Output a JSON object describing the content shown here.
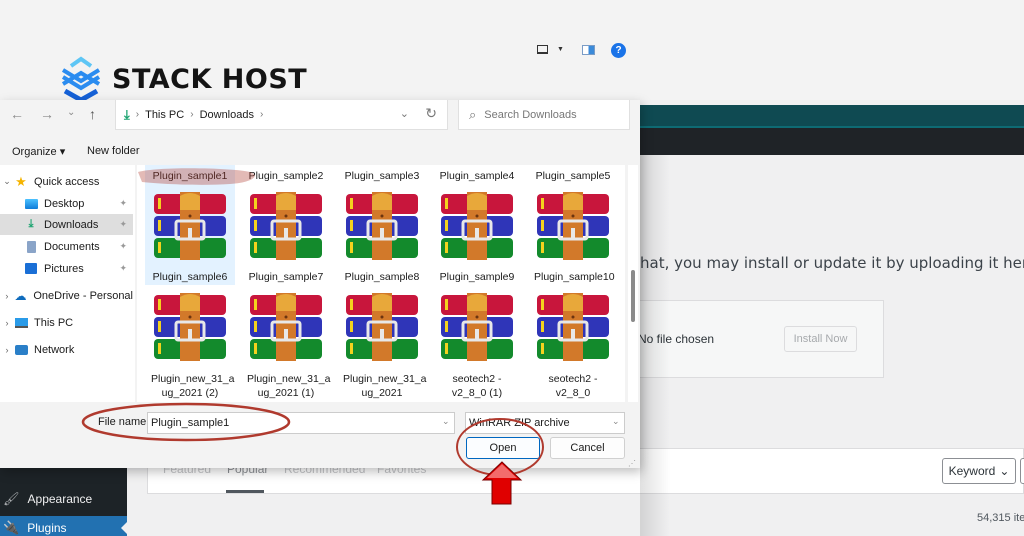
{
  "brand": {
    "name": "STACK HOST",
    "logo_icon": "stacked-chevrons-icon",
    "colors": {
      "light": "#5ec6f5",
      "mid": "#2b8cf0",
      "dark": "#1560d6"
    }
  },
  "dialog": {
    "nav": {
      "back_icon": "←",
      "forward_icon": "→",
      "recent_icon": "⌄",
      "up_icon": "↑",
      "breadcrumb": [
        "This PC",
        "Downloads"
      ],
      "breadcrumb_sep": "›",
      "dropdown_icon": "⌄",
      "refresh_icon": "↻"
    },
    "search": {
      "placeholder": "Search Downloads",
      "icon": "⌕"
    },
    "toolbar": {
      "organize_label": "Organize ▾",
      "new_folder_label": "New folder",
      "help_label": "?"
    },
    "nav_pane": {
      "items": [
        {
          "label": "Quick access",
          "icon": "star-icon",
          "chevron": "⌄",
          "pinned": false,
          "selected": false
        },
        {
          "label": "Desktop",
          "icon": "desktop-icon",
          "pinned": true,
          "selected": false
        },
        {
          "label": "Downloads",
          "icon": "download-icon",
          "pinned": true,
          "selected": true
        },
        {
          "label": "Documents",
          "icon": "documents-icon",
          "pinned": true,
          "selected": false
        },
        {
          "label": "Pictures",
          "icon": "pictures-icon",
          "pinned": true,
          "selected": false
        },
        {
          "label": "OneDrive - Personal",
          "icon": "cloud-icon",
          "chevron": "›",
          "pinned": false,
          "selected": false
        },
        {
          "label": "This PC",
          "icon": "monitor-icon",
          "chevron": "›",
          "pinned": false,
          "selected": false
        },
        {
          "label": "Network",
          "icon": "network-icon",
          "chevron": "›",
          "pinned": false,
          "selected": false
        }
      ],
      "pin_icon": "📌"
    },
    "files": {
      "row0_labels": [
        "Plugin_sample1",
        "Plugin_sample2",
        "Plugin_sample3",
        "Plugin_sample4",
        "Plugin_sample5"
      ],
      "row1_labels": [
        "Plugin_sample6",
        "Plugin_sample7",
        "Plugin_sample8",
        "Plugin_sample9",
        "Plugin_sample10"
      ],
      "row2_labels": [
        "Plugin_new_31_a ug_2021 (2)",
        "Plugin_new_31_a ug_2021 (1)",
        "Plugin_new_31_a ug_2021",
        "seotech2 - v2_8_0 (1)",
        "seotech2 - v2_8_0"
      ],
      "selected": "Plugin_sample1",
      "file_icon": "winrar-archive-icon"
    },
    "file_name_label": "File name:",
    "file_name_value": "Plugin_sample1",
    "file_type_value": "WinRAR ZIP archive",
    "open_label": "Open",
    "cancel_label": "Cancel"
  },
  "wordpress": {
    "description": "hat, you may install or update it by uploading it here.",
    "no_file": "No file chosen",
    "install_now": "Install Now",
    "filter_tabs": [
      "Featured",
      "Popular",
      "Recommended",
      "Favorites"
    ],
    "active_tab": "Popular",
    "search_type": "Keyword",
    "items_count": "54,315 ite",
    "sidebar": [
      {
        "label": "Appearance",
        "icon": "paintbrush-icon",
        "active": false
      },
      {
        "label": "Plugins",
        "icon": "plugin-icon",
        "active": true
      }
    ]
  },
  "annotations": {
    "color": "#b03a2e",
    "arrow_color": "#e00000"
  }
}
